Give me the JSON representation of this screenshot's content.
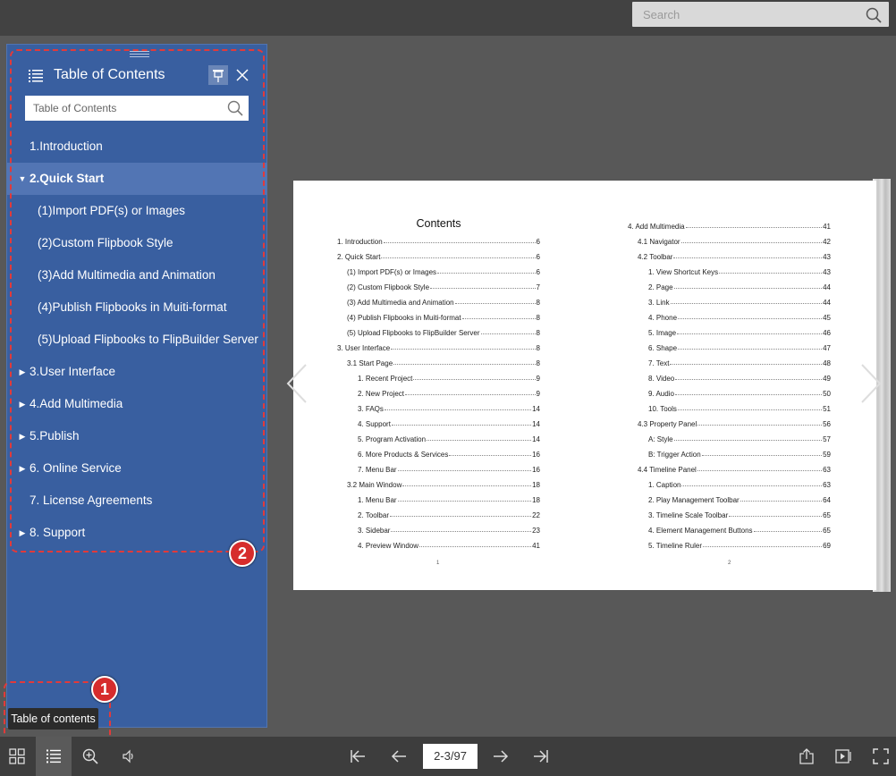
{
  "topbar": {
    "search_placeholder": "Search"
  },
  "toc": {
    "title": "Table of Contents",
    "search_placeholder": "Table of Contents",
    "items": [
      {
        "label": "1.Introduction",
        "level": 0,
        "expandable": false,
        "expanded": false,
        "active": false
      },
      {
        "label": "2.Quick Start",
        "level": 0,
        "expandable": true,
        "expanded": true,
        "active": true
      },
      {
        "label": "(1)Import PDF(s) or Images",
        "level": 1,
        "expandable": false,
        "expanded": false,
        "active": false
      },
      {
        "label": "(2)Custom Flipbook Style",
        "level": 1,
        "expandable": false,
        "expanded": false,
        "active": false
      },
      {
        "label": "(3)Add Multimedia and Animation",
        "level": 1,
        "expandable": false,
        "expanded": false,
        "active": false
      },
      {
        "label": "(4)Publish Flipbooks in Muiti-format",
        "level": 1,
        "expandable": false,
        "expanded": false,
        "active": false
      },
      {
        "label": "(5)Upload Flipbooks to FlipBuilder Server",
        "level": 1,
        "expandable": false,
        "expanded": false,
        "active": false
      },
      {
        "label": "3.User Interface",
        "level": 0,
        "expandable": true,
        "expanded": false,
        "active": false
      },
      {
        "label": "4.Add Multimedia",
        "level": 0,
        "expandable": true,
        "expanded": false,
        "active": false
      },
      {
        "label": "5.Publish",
        "level": 0,
        "expandable": true,
        "expanded": false,
        "active": false
      },
      {
        "label": "6. Online Service",
        "level": 0,
        "expandable": true,
        "expanded": false,
        "active": false
      },
      {
        "label": "7. License Agreements",
        "level": 0,
        "expandable": false,
        "expanded": false,
        "active": false
      },
      {
        "label": "8. Support",
        "level": 0,
        "expandable": true,
        "expanded": false,
        "active": false
      }
    ]
  },
  "annotations": {
    "badge1": "1",
    "badge2": "2",
    "color": "#e23a3a"
  },
  "tooltip": {
    "text": "Table of contents"
  },
  "toolbar": {
    "page_indicator": "2-3/97",
    "buttons": [
      "thumbnails-icon",
      "toc-icon",
      "zoom-in-icon",
      "sound-icon",
      "first-page-icon",
      "prev-page-icon",
      "next-page-icon",
      "last-page-icon",
      "share-icon",
      "autoplay-icon",
      "fullscreen-icon"
    ]
  },
  "book": {
    "left_page": {
      "heading": "Contents",
      "page_number": "1",
      "entries": [
        {
          "text": "1. Introduction",
          "page": "6",
          "indent": 0
        },
        {
          "text": "2. Quick Start",
          "page": "6",
          "indent": 0
        },
        {
          "text": "(1) Import PDF(s) or Images",
          "page": "6",
          "indent": 1
        },
        {
          "text": "(2) Custom Flipbook Style",
          "page": "7",
          "indent": 1
        },
        {
          "text": "(3) Add Multimedia and Animation",
          "page": "8",
          "indent": 1
        },
        {
          "text": "(4) Publish Flipbooks in Muiti-format",
          "page": "8",
          "indent": 1
        },
        {
          "text": "(5) Upload Flipbooks to FlipBuilder Server",
          "page": "8",
          "indent": 1
        },
        {
          "text": "3. User Interface",
          "page": "8",
          "indent": 0
        },
        {
          "text": "3.1 Start Page",
          "page": "8",
          "indent": 1
        },
        {
          "text": "1. Recent Project",
          "page": "9",
          "indent": 2
        },
        {
          "text": "2. New Project",
          "page": "9",
          "indent": 2
        },
        {
          "text": "3. FAQs",
          "page": "14",
          "indent": 2
        },
        {
          "text": "4. Support",
          "page": "14",
          "indent": 2
        },
        {
          "text": "5. Program Activation",
          "page": "14",
          "indent": 2
        },
        {
          "text": "6. More Products & Services",
          "page": "16",
          "indent": 2
        },
        {
          "text": "7. Menu Bar",
          "page": "16",
          "indent": 2
        },
        {
          "text": "3.2 Main Window",
          "page": "18",
          "indent": 1
        },
        {
          "text": "1. Menu Bar",
          "page": "18",
          "indent": 2
        },
        {
          "text": "2. Toolbar",
          "page": "22",
          "indent": 2
        },
        {
          "text": "3. Sidebar",
          "page": "23",
          "indent": 2
        },
        {
          "text": "4. Preview Window",
          "page": "41",
          "indent": 2
        }
      ]
    },
    "right_page": {
      "page_number": "2",
      "entries": [
        {
          "text": "4. Add Multimedia",
          "page": "41",
          "indent": 0
        },
        {
          "text": "4.1 Navigator",
          "page": "42",
          "indent": 1
        },
        {
          "text": "4.2 Toolbar",
          "page": "43",
          "indent": 1
        },
        {
          "text": "1. View Shortcut Keys",
          "page": "43",
          "indent": 2
        },
        {
          "text": "2. Page",
          "page": "44",
          "indent": 2
        },
        {
          "text": "3. Link",
          "page": "44",
          "indent": 2
        },
        {
          "text": "4. Phone",
          "page": "45",
          "indent": 2
        },
        {
          "text": "5. Image",
          "page": "46",
          "indent": 2
        },
        {
          "text": "6. Shape",
          "page": "47",
          "indent": 2
        },
        {
          "text": "7. Text",
          "page": "48",
          "indent": 2
        },
        {
          "text": "8. Video",
          "page": "49",
          "indent": 2
        },
        {
          "text": "9. Audio",
          "page": "50",
          "indent": 2
        },
        {
          "text": "10. Tools",
          "page": "51",
          "indent": 2
        },
        {
          "text": "4.3 Property Panel",
          "page": "56",
          "indent": 1
        },
        {
          "text": "A: Style",
          "page": "57",
          "indent": 2
        },
        {
          "text": "B: Trigger Action",
          "page": "59",
          "indent": 2
        },
        {
          "text": "4.4 Timeline Panel",
          "page": "63",
          "indent": 1
        },
        {
          "text": "1. Caption",
          "page": "63",
          "indent": 2
        },
        {
          "text": "2. Play Management Toolbar",
          "page": "64",
          "indent": 2
        },
        {
          "text": "3. Timeline Scale Toolbar",
          "page": "65",
          "indent": 2
        },
        {
          "text": "4. Element Management Buttons",
          "page": "65",
          "indent": 2
        },
        {
          "text": "5. Timeline Ruler",
          "page": "69",
          "indent": 2
        }
      ]
    }
  }
}
